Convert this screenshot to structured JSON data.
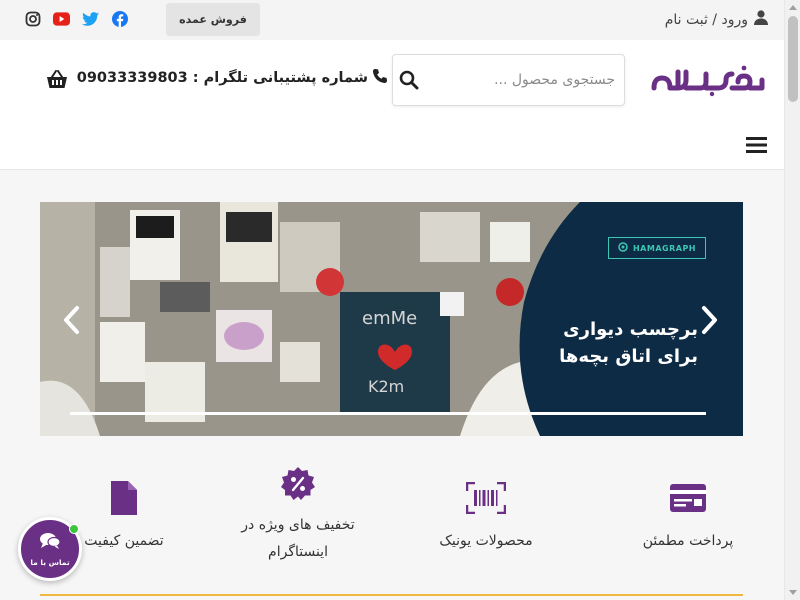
{
  "topbar": {
    "login_label": "ورود / ثبت نام",
    "wholesale_label": "فروش عمده",
    "social": [
      "instagram-icon",
      "youtube-icon",
      "twitter-icon",
      "facebook-icon"
    ]
  },
  "header": {
    "search_placeholder": "جستجوی محصول ...",
    "support_label": "شماره پشتیبانی تلگرام : 09033339803",
    "cart_icon": "basket-icon",
    "menu_icon": "hamburger-icon"
  },
  "banner": {
    "brand": "HAMAGRAPH",
    "title_line1": "برچسب دیواری",
    "title_line2": "برای اتاق بچه‌ها"
  },
  "features": [
    {
      "label": "پرداخت مطمئن",
      "icon": "credit-card-icon"
    },
    {
      "label": "محصولات یونیک",
      "icon": "barcode-icon"
    },
    {
      "label": "تخفیف های ویژه در اینستاگرام",
      "icon": "discount-badge-icon"
    },
    {
      "label": "تضمین کیفیت",
      "icon": "document-icon"
    }
  ],
  "chat": {
    "label": "تماس با ما"
  },
  "colors": {
    "brand_purple": "#6a3086",
    "banner_navy": "#0d2b44",
    "accent_teal": "#3ec6b4",
    "rule_yellow": "#f0b840"
  }
}
